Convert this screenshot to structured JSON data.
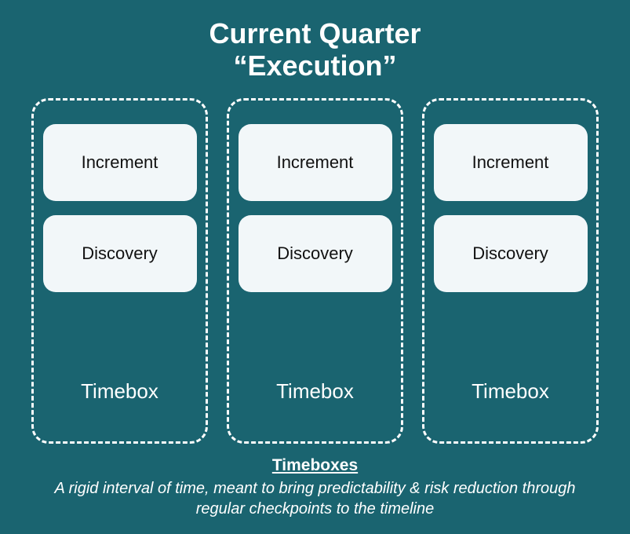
{
  "title_line1": "Current Quarter",
  "title_line2": "“Execution”",
  "columns": [
    {
      "increment": "Increment",
      "discovery": "Discovery",
      "label": "Timebox"
    },
    {
      "increment": "Increment",
      "discovery": "Discovery",
      "label": "Timebox"
    },
    {
      "increment": "Increment",
      "discovery": "Discovery",
      "label": "Timebox"
    }
  ],
  "footer": {
    "heading": "Timeboxes",
    "description": "A rigid interval of time, meant to bring predictability & risk reduction through regular checkpoints to the timeline"
  }
}
